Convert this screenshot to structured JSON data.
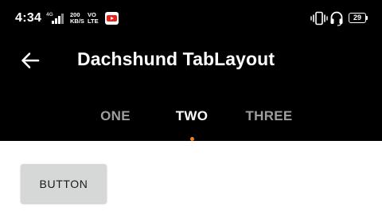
{
  "status_bar": {
    "time": "4:34",
    "network_type": "4G",
    "speed_value": "200",
    "speed_unit": "KB/S",
    "volte_line1": "VO",
    "volte_line2": "LTE",
    "battery": "29",
    "icons": [
      "signal-icon",
      "youtube-icon",
      "vibrate-icon",
      "headset-icon",
      "battery-icon"
    ]
  },
  "toolbar": {
    "title": "Dachshund TabLayout",
    "back_icon": "arrow-back-icon"
  },
  "tabs": {
    "items": [
      {
        "label": "ONE",
        "selected": false
      },
      {
        "label": "TWO",
        "selected": true
      },
      {
        "label": "THREE",
        "selected": false
      }
    ],
    "indicator_color": "#f0821e",
    "active_color": "#ffffff",
    "inactive_color": "#9e9e9e"
  },
  "content": {
    "button_label": "BUTTON"
  },
  "colors": {
    "app_bar": "#000000",
    "background": "#ffffff",
    "button": "#d6d7d7"
  }
}
